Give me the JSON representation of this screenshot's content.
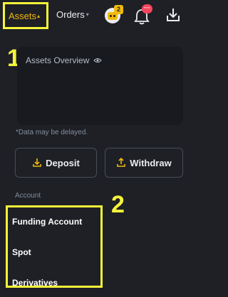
{
  "nav": {
    "assets_label": "Assets",
    "assets_caret": "▴",
    "orders_label": "Orders",
    "orders_caret": "▾",
    "avatar_badge": "2",
    "bell_badge": "···"
  },
  "markers": {
    "one": "1",
    "two": "2"
  },
  "overview": {
    "title": "Assets Overview",
    "note": "*Data may be delayed."
  },
  "actions": {
    "deposit_label": "Deposit",
    "withdraw_label": "Withdraw"
  },
  "account_section": {
    "label": "Account",
    "items": [
      {
        "label": "Funding Account"
      },
      {
        "label": "Spot"
      },
      {
        "label": "Derivatives"
      }
    ]
  },
  "colors": {
    "background": "#1e2026",
    "card": "#181a20",
    "accent": "#f0b90b",
    "highlight": "#f5f53a",
    "alert": "#f6465d"
  },
  "icons": [
    "avatar-icon",
    "bell-icon",
    "download-icon",
    "eye-icon",
    "deposit-icon",
    "withdraw-icon"
  ]
}
